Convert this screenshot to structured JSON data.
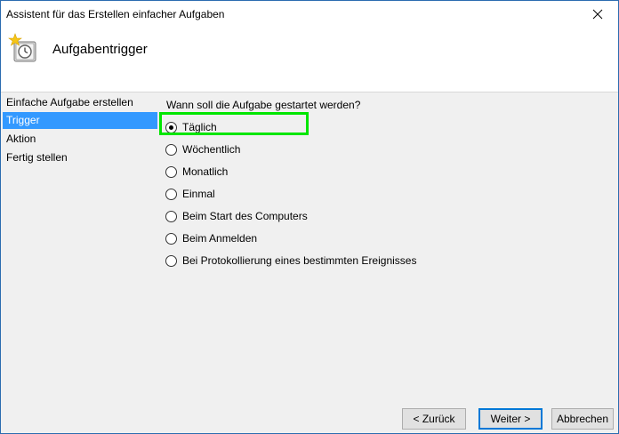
{
  "window": {
    "title": "Assistent für das Erstellen einfacher Aufgaben",
    "close_glyph": "✕"
  },
  "header": {
    "title": "Aufgabentrigger",
    "icon": "task-scheduler-icon"
  },
  "sidebar": {
    "steps": [
      {
        "label": "Einfache Aufgabe erstellen",
        "active": false
      },
      {
        "label": "Trigger",
        "active": true
      },
      {
        "label": "Aktion",
        "active": false
      },
      {
        "label": "Fertig stellen",
        "active": false
      }
    ]
  },
  "main": {
    "question": "Wann soll die Aufgabe gestartet werden?",
    "options": [
      {
        "label": "Täglich",
        "selected": true
      },
      {
        "label": "Wöchentlich",
        "selected": false
      },
      {
        "label": "Monatlich",
        "selected": false
      },
      {
        "label": "Einmal",
        "selected": false
      },
      {
        "label": "Beim Start des Computers",
        "selected": false
      },
      {
        "label": "Beim Anmelden",
        "selected": false
      },
      {
        "label": "Bei Protokollierung eines bestimmten Ereignisses",
        "selected": false
      }
    ]
  },
  "footer": {
    "back_label": "< Zurück",
    "next_label": "Weiter >",
    "cancel_label": "Abbrechen"
  },
  "colors": {
    "accent": "#3399ff",
    "highlight": "#00e600",
    "default_button_border": "#0078d7"
  }
}
